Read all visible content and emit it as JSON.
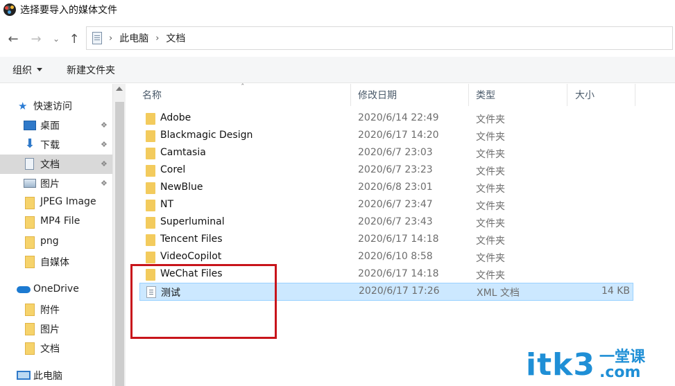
{
  "window": {
    "title": "选择要导入的媒体文件"
  },
  "address": {
    "crumbs": [
      "此电脑",
      "文档"
    ]
  },
  "toolbar": {
    "organize_label": "组织",
    "new_folder_label": "新建文件夹"
  },
  "sidebar": {
    "items": [
      {
        "label": "快速访问",
        "icon": "star-icon"
      },
      {
        "label": "桌面",
        "icon": "desktop-icon",
        "pinned": true
      },
      {
        "label": "下载",
        "icon": "download-icon",
        "pinned": true
      },
      {
        "label": "文档",
        "icon": "document-icon",
        "pinned": true,
        "selected": true
      },
      {
        "label": "图片",
        "icon": "pictures-icon",
        "pinned": true
      },
      {
        "label": "JPEG Image",
        "icon": "folder-icon"
      },
      {
        "label": "MP4 File",
        "icon": "folder-icon"
      },
      {
        "label": "png",
        "icon": "folder-icon"
      },
      {
        "label": "自媒体",
        "icon": "folder-icon"
      },
      {
        "label": "OneDrive",
        "icon": "cloud-icon"
      },
      {
        "label": "附件",
        "icon": "folder-icon"
      },
      {
        "label": "图片",
        "icon": "folder-icon"
      },
      {
        "label": "文档",
        "icon": "folder-icon"
      },
      {
        "label": "此电脑",
        "icon": "computer-icon"
      }
    ]
  },
  "columns": {
    "name": "名称",
    "modified": "修改日期",
    "type": "类型",
    "size": "大小"
  },
  "files": [
    {
      "name": "Adobe",
      "date": "2020/6/14 22:49",
      "type": "文件夹",
      "size": "",
      "icon": "folder-icon"
    },
    {
      "name": "Blackmagic Design",
      "date": "2020/6/17 14:20",
      "type": "文件夹",
      "size": "",
      "icon": "folder-icon"
    },
    {
      "name": "Camtasia",
      "date": "2020/6/7 23:03",
      "type": "文件夹",
      "size": "",
      "icon": "folder-icon"
    },
    {
      "name": "Corel",
      "date": "2020/6/7 23:23",
      "type": "文件夹",
      "size": "",
      "icon": "folder-icon"
    },
    {
      "name": "NewBlue",
      "date": "2020/6/8 23:01",
      "type": "文件夹",
      "size": "",
      "icon": "folder-icon"
    },
    {
      "name": "NT",
      "date": "2020/6/7 23:47",
      "type": "文件夹",
      "size": "",
      "icon": "folder-icon"
    },
    {
      "name": "Superluminal",
      "date": "2020/6/7 23:43",
      "type": "文件夹",
      "size": "",
      "icon": "folder-icon"
    },
    {
      "name": "Tencent Files",
      "date": "2020/6/17 14:18",
      "type": "文件夹",
      "size": "",
      "icon": "folder-icon"
    },
    {
      "name": "VideoCopilot",
      "date": "2020/6/10 8:58",
      "type": "文件夹",
      "size": "",
      "icon": "folder-icon"
    },
    {
      "name": "WeChat Files",
      "date": "2020/6/17 14:18",
      "type": "文件夹",
      "size": "",
      "icon": "folder-icon"
    },
    {
      "name": "测试",
      "date": "2020/6/17 17:26",
      "type": "XML 文档",
      "size": "14 KB",
      "icon": "xml-file-icon",
      "selected": true
    }
  ],
  "watermark": {
    "main": "itk3",
    "side_top": "一堂课",
    "side_bottom": ".com"
  },
  "colors": {
    "accent": "#1f8fd6",
    "selection": "#cce8ff",
    "highlight_box": "#c8141b",
    "folder": "#f3cb5d"
  }
}
